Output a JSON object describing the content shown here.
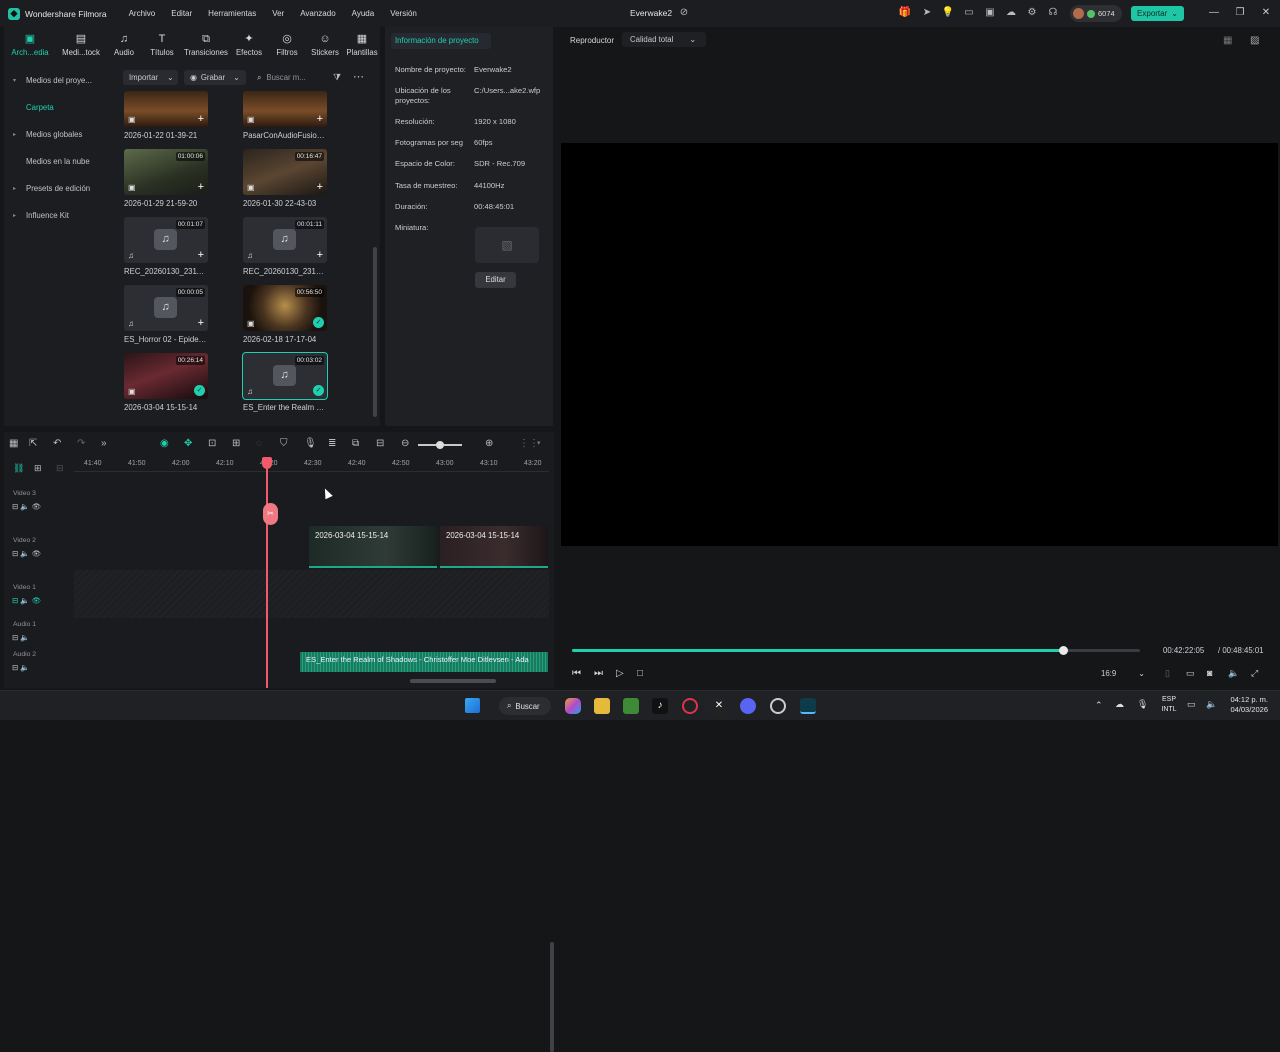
{
  "titlebar": {
    "app_name": "Wondershare Filmora",
    "menu": [
      "Archivo",
      "Editar",
      "Herramientas",
      "Ver",
      "Avanzado",
      "Ayuda",
      "Versión"
    ],
    "doc_title": "Everwake2",
    "credits": "6074",
    "export_label": "Exportar"
  },
  "media_tabs": [
    {
      "label": "Arch...edia",
      "icon": "folder-icon",
      "active": true
    },
    {
      "label": "Medi...tock",
      "icon": "stock-media-icon"
    },
    {
      "label": "Audio",
      "icon": "music-icon"
    },
    {
      "label": "Títulos",
      "icon": "text-icon"
    },
    {
      "label": "Transiciones",
      "icon": "transition-icon"
    },
    {
      "label": "Efectos",
      "icon": "effects-icon"
    },
    {
      "label": "Filtros",
      "icon": "filter-icon"
    },
    {
      "label": "Stickers",
      "icon": "sticker-icon"
    },
    {
      "label": "Plantillas",
      "icon": "template-icon"
    }
  ],
  "sidebar": {
    "items": [
      {
        "label": "Medios del proye...",
        "expanded": true
      },
      {
        "label": "Carpeta",
        "active": true
      },
      {
        "label": "Medios globales"
      },
      {
        "label": "Medios en la nube"
      },
      {
        "label": "Presets de edición"
      },
      {
        "label": "Influence Kit"
      }
    ]
  },
  "media_toolbar": {
    "import_label": "Importar",
    "record_label": "Grabar",
    "search_placeholder": "Buscar m..."
  },
  "media_items": [
    {
      "name": "2026-01-22 01-39-21",
      "duration": "",
      "kind": "video"
    },
    {
      "name": "PasarConAudioFusion...",
      "duration": "",
      "kind": "video"
    },
    {
      "name": "2026-01-29 21-59-20",
      "duration": "01:00:06",
      "kind": "video"
    },
    {
      "name": "2026-01-30 22-43-03",
      "duration": "00:16:47",
      "kind": "video"
    },
    {
      "name": "REC_20260130_231122",
      "duration": "00:01:07",
      "kind": "audio"
    },
    {
      "name": "REC_20260130_231246",
      "duration": "00:01:11",
      "kind": "audio"
    },
    {
      "name": "ES_Horror 02 - Epidem...",
      "duration": "00:00:05",
      "kind": "audio"
    },
    {
      "name": "2026-02-18 17-17-04",
      "duration": "00:56:50",
      "kind": "video",
      "used": true
    },
    {
      "name": "2026-03-04 15-15-14",
      "duration": "00:26:14",
      "kind": "video",
      "used": true
    },
    {
      "name": "ES_Enter the Realm of ...",
      "duration": "00:03:02",
      "kind": "audio",
      "used": true,
      "selected": true
    }
  ],
  "project_info": {
    "header": "Información de proyecto",
    "rows": [
      {
        "key": "Nombre de proyecto:",
        "value": "Everwake2"
      },
      {
        "key": "Ubicación de los proyectos:",
        "value": "C:/Users...ake2.wfp"
      },
      {
        "key": "Resolución:",
        "value": "1920 x 1080"
      },
      {
        "key": "Fotogramas por seg",
        "value": "60fps"
      },
      {
        "key": "Espacio de Color:",
        "value": "SDR - Rec.709"
      },
      {
        "key": "Tasa de muestreo:",
        "value": "44100Hz"
      },
      {
        "key": "Duración:",
        "value": "00:48:45:01"
      },
      {
        "key": "Miniatura:",
        "value": ""
      }
    ],
    "edit_label": "Editar"
  },
  "player": {
    "label": "Reproductor",
    "quality": "Calidad total",
    "current_time": "00:42:22:05",
    "total_time": "/ 00:48:45:01",
    "progress": 0.865,
    "aspect": "16:9"
  },
  "timeline": {
    "ruler_labels": [
      "41:40",
      "41:50",
      "42:00",
      "42:10",
      "42:20",
      "42:30",
      "42:40",
      "42:50",
      "43:00",
      "43:10",
      "43:20"
    ],
    "tracks": [
      {
        "label": "Video 3"
      },
      {
        "label": "Video 2"
      },
      {
        "label": "Video 1"
      },
      {
        "label": "Audio 1"
      },
      {
        "label": "Audio 2"
      }
    ],
    "video_clips": [
      "2026-03-04 15-15-14",
      "2026-03-04 15-15-14"
    ],
    "audio_clip": "ES_Enter the Realm of Shadows - Christoffer Moe Ditlevsen - Ada"
  },
  "taskbar": {
    "search_label": "Buscar",
    "lang_top": "ESP",
    "lang_bottom": "INTL",
    "time": "04:12 p. m.",
    "date": "04/03/2026"
  }
}
